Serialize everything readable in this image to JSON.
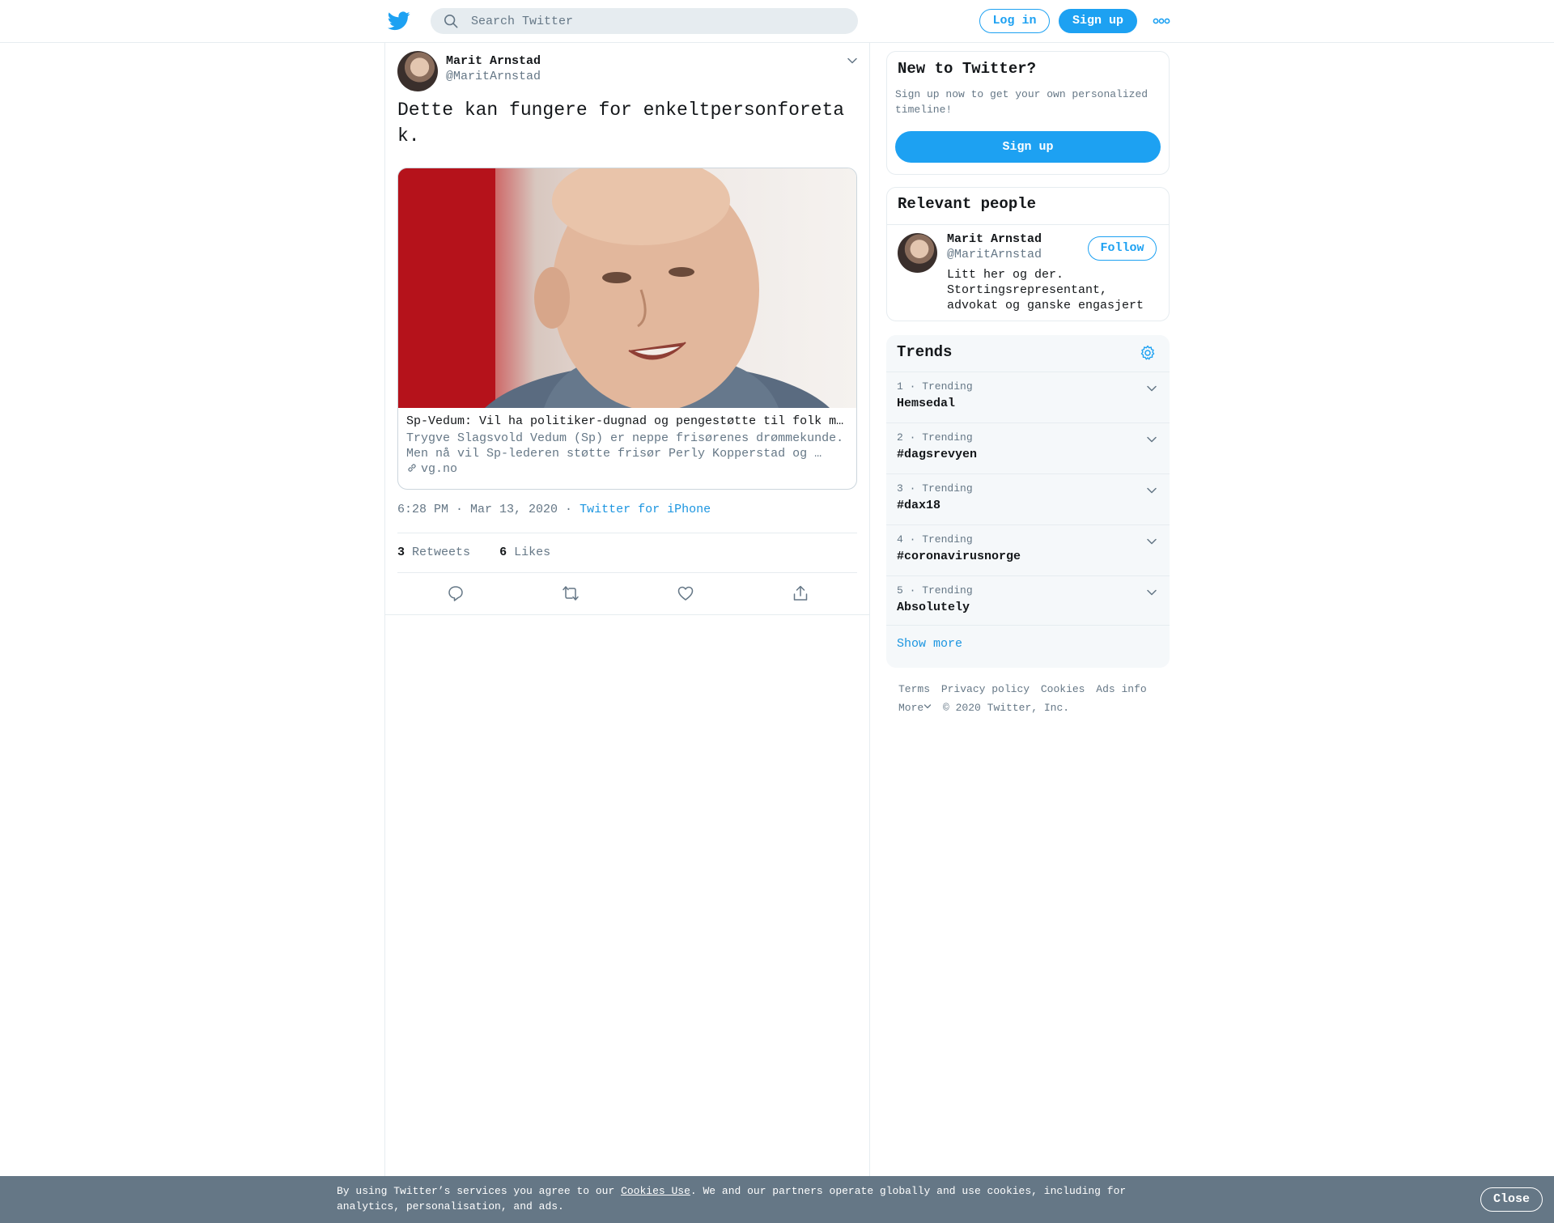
{
  "topbar": {
    "logo_icon": "twitter-bird-icon",
    "search_placeholder": "Search Twitter",
    "login_label": "Log in",
    "signup_label": "Sign up",
    "more_icon": "more-dots-icon"
  },
  "tweet": {
    "author_name": "Marit Arnstad",
    "author_handle": "@MaritArnstad",
    "text": "Dette kan fungere for enkeltpersonforetak.",
    "card": {
      "title": "Sp-Vedum: Vil ha politiker-dugnad og pengestøtte til folk med enkeltpersonforetak",
      "description": "Trygve Slagsvold Vedum (Sp) er neppe frisørenes drømmekunde. Men nå vil Sp-lederen støtte frisør Perly Kopperstad og …",
      "domain": "vg.no"
    },
    "time": "6:28 PM · Mar 13, 2020",
    "separator": " · ",
    "source": "Twitter for iPhone",
    "retweets_count": "3",
    "retweets_label": "Retweets",
    "likes_count": "6",
    "likes_label": "Likes",
    "action_icons": [
      "reply-icon",
      "retweet-icon",
      "like-icon",
      "share-icon"
    ]
  },
  "new_to_twitter": {
    "heading": "New to Twitter?",
    "text": "Sign up now to get your own personalized timeline!",
    "button": "Sign up"
  },
  "relevant_people": {
    "heading": "Relevant people",
    "name": "Marit Arnstad",
    "handle": "@MaritArnstad",
    "bio": "Litt her og der. Stortingsrepresentant, advokat og ganske engasjert",
    "follow_label": "Follow"
  },
  "trends": {
    "heading": "Trends",
    "items": [
      {
        "meta": "1 · Trending",
        "name": "Hemsedal"
      },
      {
        "meta": "2 · Trending",
        "name": "#dagsrevyen"
      },
      {
        "meta": "3 · Trending",
        "name": "#dax18"
      },
      {
        "meta": "4 · Trending",
        "name": "#coronavirusnorge"
      },
      {
        "meta": "5 · Trending",
        "name": "Absolutely"
      }
    ],
    "show_more": "Show more"
  },
  "footer": {
    "links": [
      "Terms",
      "Privacy policy",
      "Cookies",
      "Ads info"
    ],
    "more": "More",
    "copyright": "© 2020 Twitter, Inc."
  },
  "cookie_bar": {
    "text_before": "By using Twitter’s services you agree to our ",
    "link": "Cookies Use",
    "text_after": ". We and our partners operate globally and use cookies, including for analytics, personalisation, and ads.",
    "close_label": "Close"
  },
  "colors": {
    "accent": "#1da1f2",
    "link": "#1b95e0",
    "muted": "#657786",
    "border": "#e6ecf0",
    "cookie_bg": "#657786"
  }
}
